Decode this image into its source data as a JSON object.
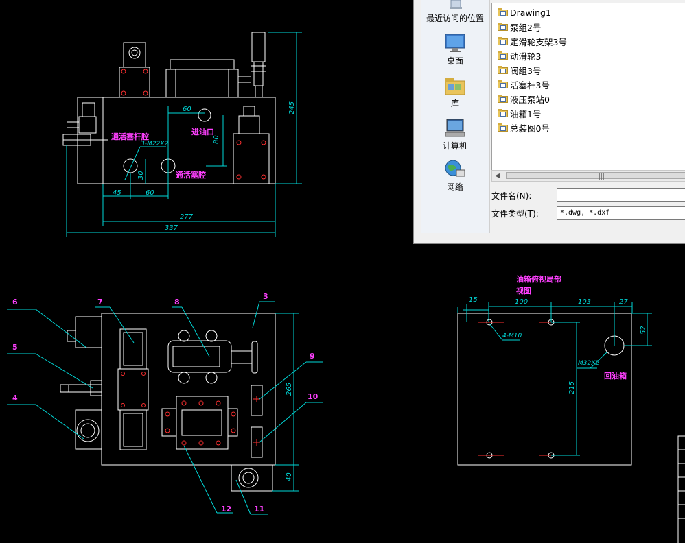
{
  "dialog": {
    "places": [
      {
        "label": "最近访问的位置",
        "icon": "recent-places-icon"
      },
      {
        "label": "桌面",
        "icon": "desktop-icon"
      },
      {
        "label": "库",
        "icon": "library-icon"
      },
      {
        "label": "计算机",
        "icon": "computer-icon"
      },
      {
        "label": "网络",
        "icon": "network-icon"
      }
    ],
    "files": [
      "Drawing1",
      "泵组2号",
      "定滑轮支架3号",
      "动滑轮3",
      "阀组3号",
      "活塞杆3号",
      "液压泵站0",
      "油箱1号",
      "总装图0号"
    ],
    "filename_label": "文件名(N):",
    "filename_value": "",
    "filetype_label": "文件类型(T):",
    "filetype_value": "*.dwg, *.dxf"
  },
  "drawing": {
    "front_view": {
      "dims": {
        "d60": "60",
        "d80": "80",
        "d30": "30",
        "d45": "45",
        "d60b": "60",
        "d277": "277",
        "d337": "337",
        "d245": "245"
      },
      "thread": "3-M22X2",
      "labels": {
        "rod_chamber": "通活塞杆腔",
        "oil_inlet": "进油口",
        "piston_chamber": "通活塞腔"
      }
    },
    "top_view": {
      "balloons": [
        "6",
        "7",
        "8",
        "3",
        "5",
        "9",
        "4",
        "10",
        "12",
        "11"
      ],
      "dims": {
        "d265": "265",
        "d40": "40"
      }
    },
    "tank_view": {
      "title_line1": "油箱俯视局部",
      "title_line2": "视图",
      "dims": {
        "d15": "15",
        "d100": "100",
        "d103": "103",
        "d27": "27",
        "d52": "52",
        "d215": "215"
      },
      "thread_holes": "4-M10",
      "thread_return": "M32X2",
      "return_label": "回油箱"
    }
  },
  "colors": {
    "background": "#000000",
    "line": "#ffffff",
    "dimension": "#00d8d8",
    "text_magenta": "#ff40ff",
    "center_red": "#ff3030"
  }
}
